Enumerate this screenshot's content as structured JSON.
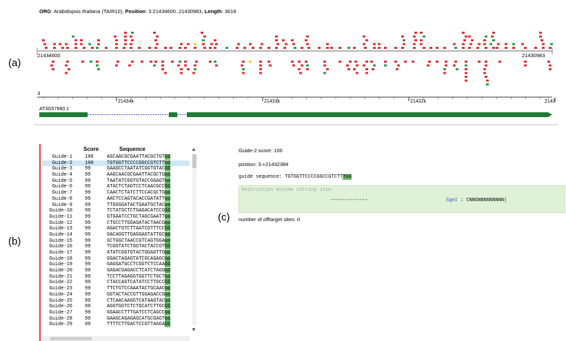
{
  "panel_labels": {
    "a": "(a)",
    "b": "(b)",
    "c": "(c)"
  },
  "genome": {
    "org_label": "ORG",
    "organism": "Arabidopsis thaliana (TAIR10)",
    "position_label": "Position",
    "position": "3:21434600..21430983",
    "length_label": "Length",
    "length": "3618",
    "coord_left": "21434600",
    "coord_right": "21430983",
    "chromosome": "3",
    "ruler_ticks": [
      "21434k",
      "21433k",
      "21432k",
      "2143"
    ],
    "gene_name": "AT3G57880.1",
    "colors": {
      "high": "#e03131",
      "medium": "#2f9a4a",
      "low": "#f2d20a",
      "gene": "#1e7a34",
      "intron": "#3b3bd9"
    }
  },
  "guides": {
    "header": {
      "score": "Score",
      "sequence": "Sequence"
    },
    "selected_index": 1,
    "rows": [
      {
        "name": "Guide-1",
        "score": "100",
        "seq": "AGCAACGCGAATTACGCTGT",
        "pam": "GG"
      },
      {
        "name": "Guide-2",
        "score": "100",
        "seq": "TGTGGTTCCCCGGCCGTCTT",
        "pam": "GG"
      },
      {
        "name": "Guide-3",
        "score": "99",
        "seq": "GAAGCCTAATATCGGTGTAC",
        "pam": "GG"
      },
      {
        "name": "Guide-4",
        "score": "99",
        "seq": "AAGCAACGCGAATTACGCTG",
        "pam": "GG"
      },
      {
        "name": "Guide-5",
        "score": "99",
        "seq": "TAATATCGGTGTACCGGAGT",
        "pam": "GG"
      },
      {
        "name": "Guide-6",
        "score": "99",
        "seq": "ATACTCTAGTCCTCAACGCC",
        "pam": "GG"
      },
      {
        "name": "Guide-7",
        "score": "99",
        "seq": "CAACTCTATCTTCCACGCTG",
        "pam": "GG"
      },
      {
        "name": "Guide-8",
        "score": "99",
        "seq": "AACTCCAGTACACCGATATT",
        "pam": "GG"
      },
      {
        "name": "Guide-9",
        "score": "99",
        "seq": "TTGGGGATACTGAATGCTAC",
        "pam": "GG"
      },
      {
        "name": "Guide-10",
        "score": "99",
        "seq": "TCTATGCTCTGAGACATCCG",
        "pam": "GG"
      },
      {
        "name": "Guide-11",
        "score": "99",
        "seq": "GTGAATCCTGCTAGCGAATT",
        "pam": "GG"
      },
      {
        "name": "Guide-12",
        "score": "99",
        "seq": "CTGCCTTGGAGATACTAACG",
        "pam": "GG"
      },
      {
        "name": "Guide-13",
        "score": "99",
        "seq": "AGACTGTCTTAATCGTTTCC",
        "pam": "GG"
      },
      {
        "name": "Guide-14",
        "score": "99",
        "seq": "GACAGGTTGAGGAGTATTGC",
        "pam": "GG"
      },
      {
        "name": "Guide-15",
        "score": "99",
        "seq": "GCTGGCTAACCGTCAGTGGA",
        "pam": "GG"
      },
      {
        "name": "Guide-16",
        "score": "99",
        "seq": "TCGGTATCTGGTACTACCGT",
        "pam": "GG"
      },
      {
        "name": "Guide-17",
        "score": "99",
        "seq": "ATATCGGTGTACTGGAGTTG",
        "pam": "GG"
      },
      {
        "name": "Guide-18",
        "score": "99",
        "seq": "GGACTAGAGTATCGCAGAGC",
        "pam": "GG"
      },
      {
        "name": "Guide-19",
        "score": "99",
        "seq": "GAGGATGCCTCGGTCTCCAA",
        "pam": "GG"
      },
      {
        "name": "Guide-20",
        "score": "99",
        "seq": "GAGACGAGACCTCATCTAGG",
        "pam": "GG"
      },
      {
        "name": "Guide-21",
        "score": "99",
        "seq": "TCCTTAGAGGTGGTTCTGCT",
        "pam": "GG"
      },
      {
        "name": "Guide-22",
        "score": "99",
        "seq": "CTACCAGTCATATCCTTGCC",
        "pam": "GG"
      },
      {
        "name": "Guide-23",
        "score": "99",
        "seq": "TTCTGTCCAAATACTGCAAC",
        "pam": "GG"
      },
      {
        "name": "Guide-24",
        "score": "99",
        "seq": "GGTACTACCGTTGGAGACCG",
        "pam": "GG"
      },
      {
        "name": "Guide-25",
        "score": "99",
        "seq": "CTCAACAAGGTCATAAGTAC",
        "pam": "GG"
      },
      {
        "name": "Guide-26",
        "score": "99",
        "seq": "AGGTGGTCTCTGCATCTTGC",
        "pam": "GG"
      },
      {
        "name": "Guide-27",
        "score": "99",
        "seq": "GGAACCTTTGATCCTCAGCC",
        "pam": "GG"
      },
      {
        "name": "Guide-28",
        "score": "99",
        "seq": "GAAGCAGAGAGCATGCGAGT",
        "pam": "GG"
      },
      {
        "name": "Guide-29",
        "score": "99",
        "seq": "TTTTCTTGACTCCGTTAGGA",
        "pam": "GG"
      }
    ]
  },
  "detail": {
    "score_line": "Guide-2 score: 100",
    "position_line": "postion: 3:+21432384",
    "guide_label": "guide sequence: ",
    "guide_seq": "TGTGGTTCCCCGGCCGTCTT",
    "guide_pam": "TGG",
    "restriction_title": "Restriction enzyme cutting site",
    "restriction_dashes": "-------------",
    "enzyme_name": "SgeI",
    "enzyme_pattern": " : CNNGNNNNNNNNN|",
    "offtarget_line": "number of offtarget sites: 0"
  }
}
